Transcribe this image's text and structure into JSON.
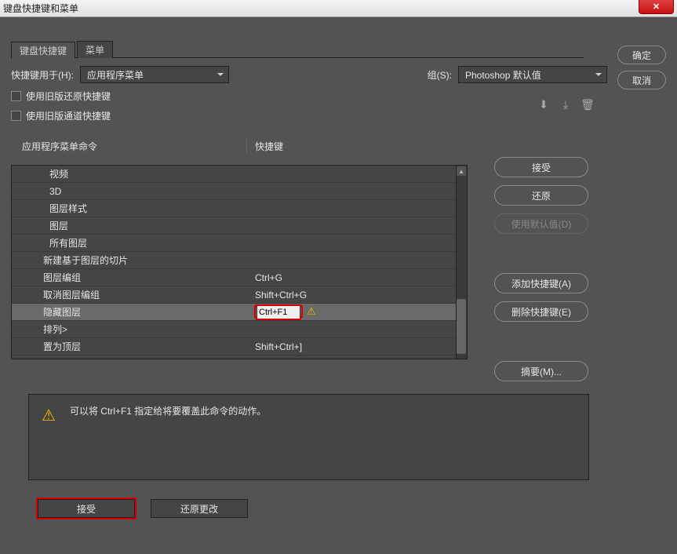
{
  "title": "键盘快捷键和菜单",
  "tabs": {
    "shortcuts": "键盘快捷键",
    "menus": "菜单"
  },
  "labels": {
    "shortcutsFor": "快捷键用于(H):",
    "set": "组(S):",
    "useLegacyUndo": "使用旧版还原快捷键",
    "useLegacyChannel": "使用旧版通道快捷键",
    "col1": "应用程序菜单命令",
    "col2": "快捷键"
  },
  "dropdowns": {
    "shortcutsFor": "应用程序菜单",
    "set": "Photoshop 默认值"
  },
  "rows": [
    {
      "name": "视频",
      "shortcut": ""
    },
    {
      "name": "3D",
      "shortcut": ""
    },
    {
      "name": "图层样式",
      "shortcut": ""
    },
    {
      "name": "图层",
      "shortcut": ""
    },
    {
      "name": "所有图层",
      "shortcut": ""
    },
    {
      "name": "新建基于图层的切片",
      "shortcut": "",
      "indent": true
    },
    {
      "name": "图层编组",
      "shortcut": "Ctrl+G",
      "indent": true
    },
    {
      "name": "取消图层编组",
      "shortcut": "Shift+Ctrl+G",
      "indent": true
    },
    {
      "name": "隐藏图层",
      "shortcut": "Ctrl+F1",
      "selected": true,
      "editing": true,
      "warn": true,
      "indent": true
    },
    {
      "name": "排列>",
      "shortcut": "",
      "indent": true
    },
    {
      "name": "置为顶层",
      "shortcut": "Shift+Ctrl+]",
      "indent": true
    }
  ],
  "buttons": {
    "ok": "确定",
    "cancel": "取消",
    "accept": "接受",
    "undo": "还原",
    "useDefault": "使用默认值(D)",
    "addShortcut": "添加快捷键(A)",
    "deleteShortcut": "删除快捷键(E)",
    "summary": "摘要(M)...",
    "acceptBottom": "接受",
    "undoChanges": "还原更改"
  },
  "message": "可以将 Ctrl+F1 指定给将要覆盖此命令的动作。"
}
